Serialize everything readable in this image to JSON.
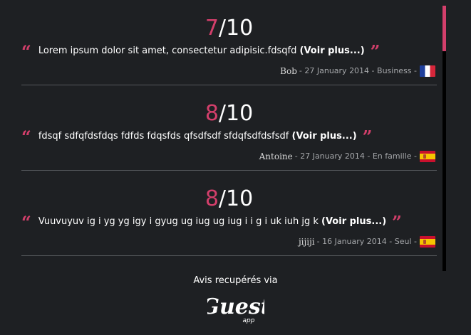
{
  "reviews": [
    {
      "score": "7",
      "out_of": "/10",
      "text": "Lorem ipsum dolor sit amet, consectetur adipisic.fdsqfd",
      "more": "(Voir plus...)",
      "author": "Bob",
      "details": " - 27 January 2014 - Business - ",
      "flag": "france-flag"
    },
    {
      "score": "8",
      "out_of": "/10",
      "text": "fdsqf sdfqfdsfdqs fdfds fdqsfds qfsdfsdf sfdqfsdfdsfsdf",
      "more": "(Voir plus...)",
      "author": "Antoine",
      "details": " - 27 January 2014 - En famille - ",
      "flag": "spain-flag"
    },
    {
      "score": "8",
      "out_of": "/10",
      "text": "Vuuvuyuv ig i yg yg igy i gyug ug iug ug iug i i g i uk iuh jg k",
      "more": "(Voir plus...)",
      "author": "jijiji",
      "details": " - 16 January 2014 - Seul - ",
      "flag": "spain-flag"
    }
  ],
  "quotes": {
    "open": "“",
    "close": "”"
  },
  "footer": {
    "source_label": "Avis recupérés via",
    "logo_text": "Guest",
    "logo_subtext": "app"
  },
  "colors": {
    "accent": "#d33f6b",
    "background": "#1e2023",
    "divider": "#55585c",
    "meta_text": "#a6a8ab"
  }
}
